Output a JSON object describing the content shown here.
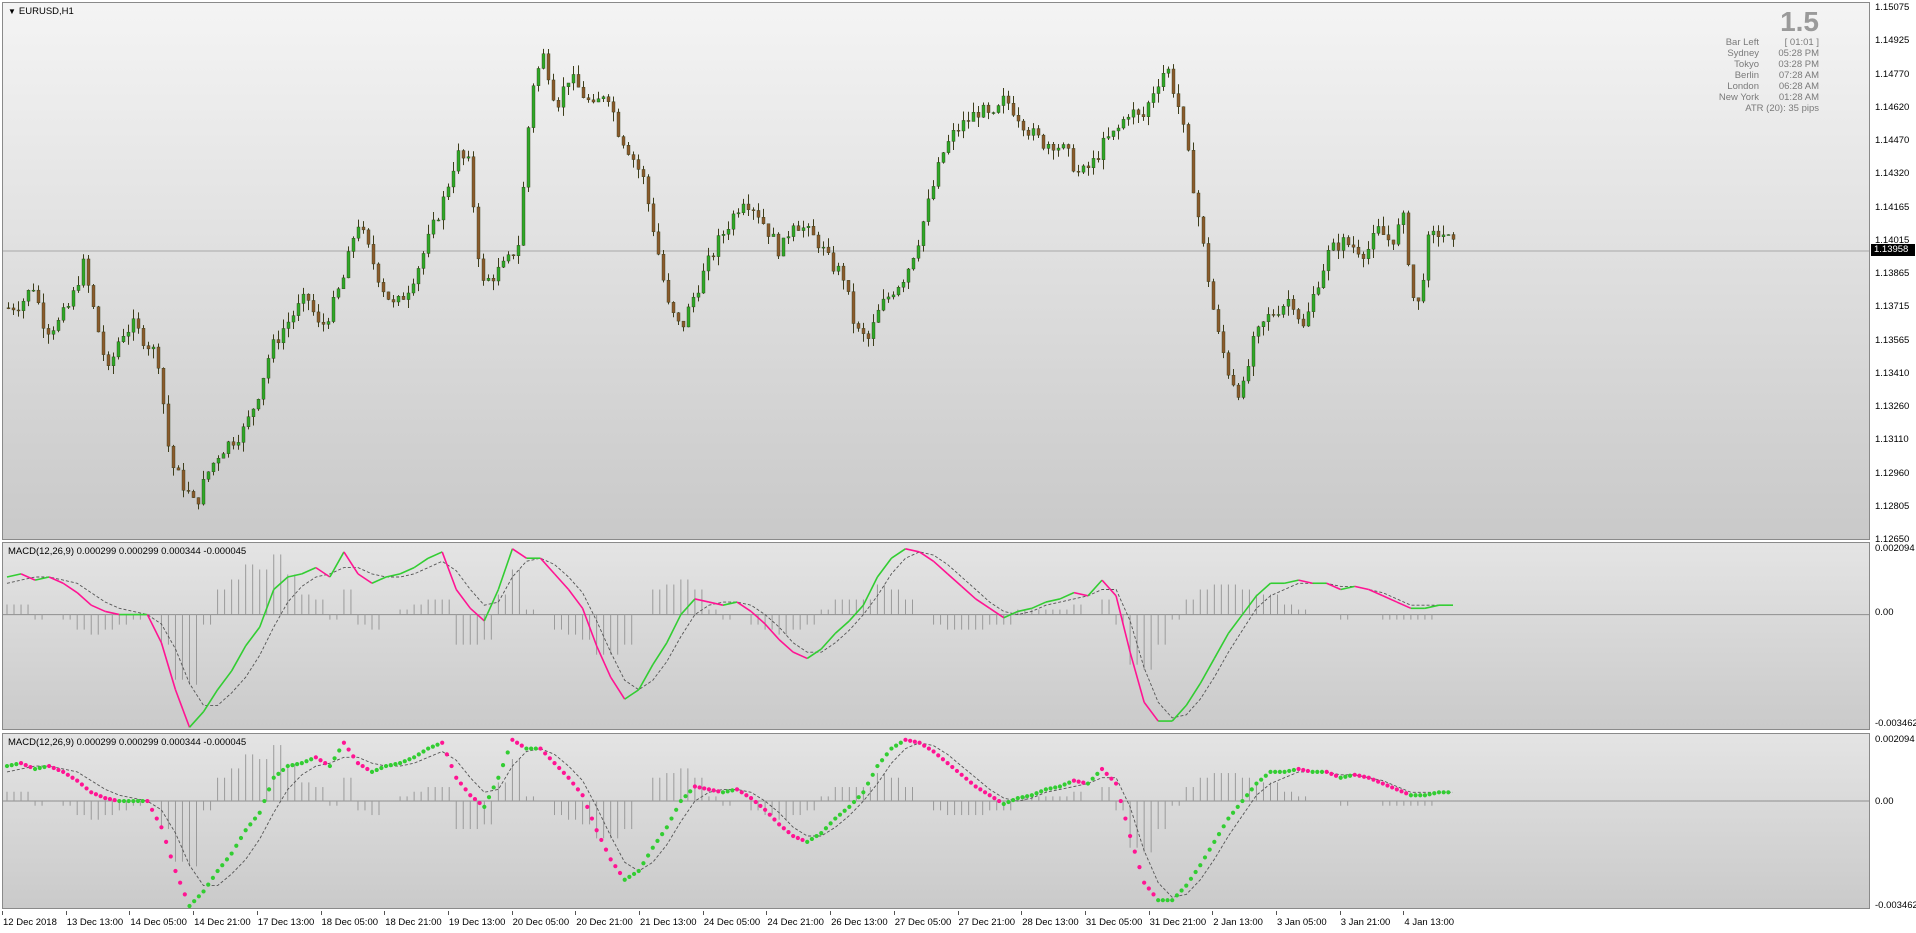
{
  "main": {
    "symbol_label": "EURUSD,H1",
    "current_price": "1.13958",
    "price_axis": [
      "1.15075",
      "1.14925",
      "1.14770",
      "1.14620",
      "1.14470",
      "1.14320",
      "1.14165",
      "1.14015",
      "1.13865",
      "1.13715",
      "1.13565",
      "1.13410",
      "1.13260",
      "1.13110",
      "1.12960",
      "1.12805",
      "1.12650"
    ],
    "bull_color": "#2fa827",
    "bear_color": "#8a5a2c"
  },
  "info_panel": {
    "big_value": "1.5",
    "rows": [
      {
        "label": "Bar Left",
        "value": "[ 01:01 ]"
      },
      {
        "label": "Sydney",
        "value": "05:28 PM"
      },
      {
        "label": "Tokyo",
        "value": "03:28 PM"
      },
      {
        "label": "Berlin",
        "value": "07:28 AM"
      },
      {
        "label": "London",
        "value": "06:28 AM"
      },
      {
        "label": "New York",
        "value": "01:28 AM"
      }
    ],
    "atr": "ATR (20): 35 pips"
  },
  "macd1": {
    "label": "MACD(12,26,9) 0.000299 0.000299 0.000344 -0.000045",
    "axis": [
      "0.002094",
      "0.00",
      "-0.003462"
    ]
  },
  "macd2": {
    "label": "MACD(12,26,9) 0.000299 0.000299 0.000344 -0.000045",
    "axis": [
      "0.002094",
      "0.00",
      "-0.003462"
    ]
  },
  "time_axis": [
    "12 Dec 2018",
    "13 Dec 13:00",
    "14 Dec 05:00",
    "14 Dec 21:00",
    "17 Dec 13:00",
    "18 Dec 05:00",
    "18 Dec 21:00",
    "19 Dec 13:00",
    "20 Dec 05:00",
    "20 Dec 21:00",
    "21 Dec 13:00",
    "24 Dec 05:00",
    "24 Dec 21:00",
    "26 Dec 13:00",
    "27 Dec 05:00",
    "27 Dec 21:00",
    "28 Dec 13:00",
    "31 Dec 05:00",
    "31 Dec 21:00",
    "2 Jan 13:00",
    "3 Jan 05:00",
    "3 Jan 21:00",
    "4 Jan 13:00"
  ],
  "colors": {
    "macd_up": "#32cd32",
    "macd_down": "#ff1493",
    "signal": "#555555",
    "hist": "#9a9a9a"
  },
  "chart_data": [
    {
      "type": "candlestick",
      "title": "EURUSD,H1",
      "ylim": [
        1.1265,
        1.15075
      ],
      "x": [
        "12 Dec 2018",
        "13 Dec 13:00",
        "14 Dec 05:00",
        "14 Dec 21:00",
        "17 Dec 13:00",
        "18 Dec 05:00",
        "18 Dec 21:00",
        "19 Dec 13:00",
        "20 Dec 05:00",
        "20 Dec 21:00",
        "21 Dec 13:00",
        "24 Dec 05:00",
        "24 Dec 21:00",
        "26 Dec 13:00",
        "27 Dec 05:00",
        "27 Dec 21:00",
        "28 Dec 13:00",
        "31 Dec 05:00",
        "31 Dec 21:00",
        "2 Jan 13:00",
        "3 Jan 05:00",
        "3 Jan 21:00",
        "4 Jan 13:00"
      ],
      "close_path": [
        1.137,
        1.1372,
        1.138,
        1.136,
        1.1363,
        1.1372,
        1.139,
        1.1365,
        1.134,
        1.1358,
        1.1362,
        1.1355,
        1.1348,
        1.13,
        1.129,
        1.128,
        1.1295,
        1.1305,
        1.131,
        1.1315,
        1.133,
        1.135,
        1.136,
        1.1368,
        1.1375,
        1.136,
        1.137,
        1.1385,
        1.141,
        1.1395,
        1.138,
        1.137,
        1.1378,
        1.139,
        1.1405,
        1.142,
        1.144,
        1.1435,
        1.138,
        1.1385,
        1.139,
        1.14,
        1.147,
        1.1485,
        1.1462,
        1.1475,
        1.1468,
        1.146,
        1.147,
        1.145,
        1.144,
        1.1428,
        1.14,
        1.137,
        1.136,
        1.1375,
        1.1388,
        1.14,
        1.141,
        1.142,
        1.1415,
        1.1405,
        1.1395,
        1.141,
        1.1405,
        1.14,
        1.139,
        1.1385,
        1.136,
        1.1355,
        1.137,
        1.1378,
        1.1385,
        1.14,
        1.142,
        1.144,
        1.145,
        1.1455,
        1.146,
        1.1455,
        1.1465,
        1.1458,
        1.145,
        1.1445,
        1.1445,
        1.144,
        1.143,
        1.1435,
        1.1445,
        1.145,
        1.146,
        1.1455,
        1.147,
        1.148,
        1.146,
        1.143,
        1.1395,
        1.136,
        1.134,
        1.133,
        1.1355,
        1.1365,
        1.137,
        1.1375,
        1.136,
        1.138,
        1.1395,
        1.14,
        1.1398,
        1.1395,
        1.1405,
        1.14,
        1.141,
        1.1365,
        1.14,
        1.1405,
        1.1398
      ]
    },
    {
      "type": "line",
      "title": "MACD(12,26,9) 0.000299 0.000299 0.000344 -0.000045",
      "ylim": [
        -0.003462,
        0.002094
      ],
      "series": [
        {
          "name": "MACD",
          "values": [
            0.0012,
            0.0013,
            0.0011,
            0.0012,
            0.001,
            0.0007,
            0.0003,
            0.0001,
            0.0,
            0.0,
            0.0,
            -0.0009,
            -0.0024,
            -0.0036,
            -0.0031,
            -0.0024,
            -0.0018,
            -0.001,
            -0.0004,
            0.0008,
            0.0012,
            0.0013,
            0.0015,
            0.0012,
            0.002,
            0.0013,
            0.001,
            0.0012,
            0.0013,
            0.0015,
            0.0018,
            0.002,
            0.0008,
            0.0002,
            -0.0002,
            0.0008,
            0.0021,
            0.0018,
            0.0018,
            0.0013,
            0.0008,
            0.0002,
            -0.001,
            -0.002,
            -0.0027,
            -0.0024,
            -0.0016,
            -0.0009,
            0.0,
            0.0005,
            0.0004,
            0.0003,
            0.0004,
            0.0001,
            -0.0003,
            -0.0008,
            -0.0012,
            -0.0014,
            -0.0011,
            -0.0006,
            -0.0002,
            0.0003,
            0.0012,
            0.0018,
            0.0021,
            0.002,
            0.0017,
            0.0013,
            0.0009,
            0.0005,
            0.0002,
            -0.0001,
            0.0001,
            0.0002,
            0.0004,
            0.0005,
            0.0007,
            0.0006,
            0.0011,
            0.0006,
            -0.0012,
            -0.0028,
            -0.0034,
            -0.0034,
            -0.0029,
            -0.0022,
            -0.0014,
            -0.0006,
            0.0,
            0.0006,
            0.001,
            0.001,
            0.0011,
            0.001,
            0.001,
            0.0008,
            0.0009,
            0.0008,
            0.0006,
            0.0004,
            0.0002,
            0.0002,
            0.0003,
            0.0003
          ]
        },
        {
          "name": "Signal",
          "values": [
            0.001,
            0.0011,
            0.0012,
            0.0012,
            0.0011,
            0.001,
            0.0007,
            0.0004,
            0.0002,
            0.0001,
            0.0,
            -0.0003,
            -0.0011,
            -0.0022,
            -0.0029,
            -0.0029,
            -0.0025,
            -0.002,
            -0.0013,
            -0.0004,
            0.0004,
            0.0009,
            0.0012,
            0.0013,
            0.0015,
            0.0015,
            0.0013,
            0.0012,
            0.0012,
            0.0013,
            0.0015,
            0.0017,
            0.0014,
            0.0008,
            0.0003,
            0.0004,
            0.0012,
            0.0017,
            0.0018,
            0.0016,
            0.0012,
            0.0007,
            -0.0002,
            -0.0012,
            -0.0021,
            -0.0024,
            -0.0021,
            -0.0015,
            -0.0007,
            0.0,
            0.0003,
            0.0004,
            0.0004,
            0.0003,
            0.0,
            -0.0004,
            -0.0009,
            -0.0012,
            -0.0012,
            -0.0009,
            -0.0005,
            0.0,
            0.0006,
            0.0013,
            0.0018,
            0.002,
            0.0019,
            0.0016,
            0.0012,
            0.0008,
            0.0004,
            0.0001,
            0.0,
            0.0001,
            0.0003,
            0.0004,
            0.0005,
            0.0006,
            0.0008,
            0.0008,
            -0.0002,
            -0.0017,
            -0.0028,
            -0.0033,
            -0.0032,
            -0.0027,
            -0.002,
            -0.0012,
            -0.0005,
            0.0002,
            0.0006,
            0.0008,
            0.001,
            0.001,
            0.001,
            0.0009,
            0.0009,
            0.0008,
            0.0007,
            0.0005,
            0.0003,
            0.0003,
            0.0003,
            0.0003
          ]
        }
      ]
    }
  ]
}
